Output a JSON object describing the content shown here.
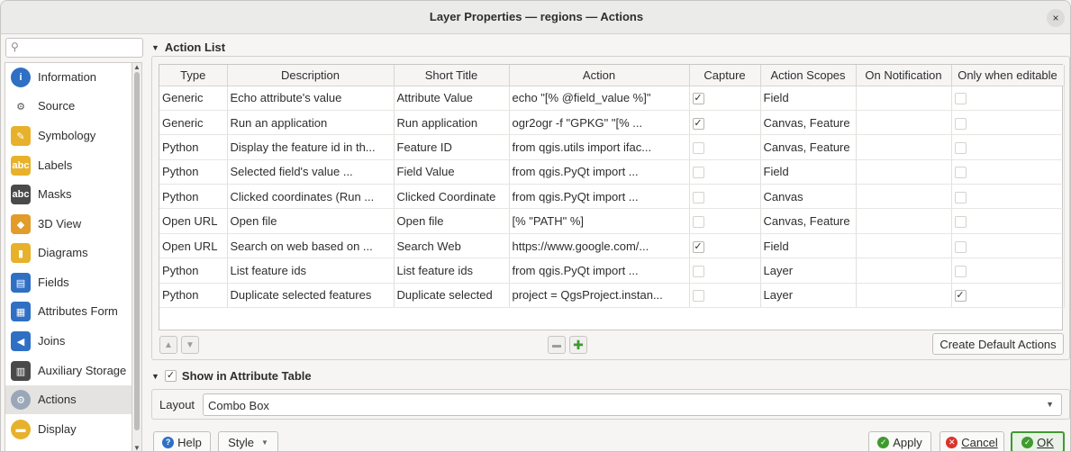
{
  "window": {
    "title": "Layer Properties — regions — Actions",
    "close_glyph": "×"
  },
  "search": {
    "placeholder": ""
  },
  "sidebar": {
    "items": [
      {
        "label": "Information",
        "icon": "info-icon"
      },
      {
        "label": "Source",
        "icon": "source-icon"
      },
      {
        "label": "Symbology",
        "icon": "symbology-icon"
      },
      {
        "label": "Labels",
        "icon": "labels-icon"
      },
      {
        "label": "Masks",
        "icon": "masks-icon"
      },
      {
        "label": "3D View",
        "icon": "3d-view-icon"
      },
      {
        "label": "Diagrams",
        "icon": "diagrams-icon"
      },
      {
        "label": "Fields",
        "icon": "fields-icon"
      },
      {
        "label": "Attributes Form",
        "icon": "attributes-form-icon"
      },
      {
        "label": "Joins",
        "icon": "joins-icon"
      },
      {
        "label": "Auxiliary Storage",
        "icon": "auxiliary-storage-icon"
      },
      {
        "label": "Actions",
        "icon": "actions-icon",
        "active": true
      },
      {
        "label": "Display",
        "icon": "display-icon"
      }
    ]
  },
  "action_list": {
    "title": "Action List",
    "columns": [
      "Type",
      "Description",
      "Short Title",
      "Action",
      "Capture",
      "Action Scopes",
      "On Notification",
      "Only when editable"
    ],
    "rows": [
      {
        "type": "Generic",
        "description": "Echo attribute's value",
        "short_title": "Attribute Value",
        "action": "echo \"[% @field_value %]\"",
        "capture": true,
        "scopes": "Field",
        "notification": "",
        "editable": false
      },
      {
        "type": "Generic",
        "description": "Run an application",
        "short_title": "Run application",
        "action": "ogr2ogr -f \"GPKG\" \"[% ...",
        "capture": true,
        "scopes": "Canvas, Feature",
        "notification": "",
        "editable": false
      },
      {
        "type": "Python",
        "description": "Display the feature id in th...",
        "short_title": "Feature ID",
        "action": "from qgis.utils import ifac...",
        "capture": false,
        "scopes": "Canvas, Feature",
        "notification": "",
        "editable": false
      },
      {
        "type": "Python",
        "description": "Selected field's value ...",
        "short_title": "Field Value",
        "action": "from qgis.PyQt import ...",
        "capture": false,
        "scopes": "Field",
        "notification": "",
        "editable": false
      },
      {
        "type": "Python",
        "description": "Clicked coordinates (Run ...",
        "short_title": "Clicked Coordinate",
        "action": "from qgis.PyQt import ...",
        "capture": false,
        "scopes": "Canvas",
        "notification": "",
        "editable": false
      },
      {
        "type": "Open URL",
        "description": "Open file",
        "short_title": "Open file",
        "action": "[% \"PATH\" %]",
        "capture": false,
        "scopes": "Canvas, Feature",
        "notification": "",
        "editable": false
      },
      {
        "type": "Open URL",
        "description": "Search on web based on ...",
        "short_title": "Search Web",
        "action": "https://www.google.com/...",
        "capture": true,
        "scopes": "Field",
        "notification": "",
        "editable": false
      },
      {
        "type": "Python",
        "description": "List feature ids",
        "short_title": "List feature ids",
        "action": "from qgis.PyQt import ...",
        "capture": false,
        "scopes": "Layer",
        "notification": "",
        "editable": false
      },
      {
        "type": "Python",
        "description": "Duplicate selected features",
        "short_title": "Duplicate selected",
        "action": "project = QgsProject.instan...",
        "capture": false,
        "scopes": "Layer",
        "notification": "",
        "editable": true
      }
    ],
    "create_default_label": "Create Default Actions"
  },
  "show_in_table": {
    "label": "Show in Attribute Table",
    "checked": true
  },
  "layout": {
    "label": "Layout",
    "value": "Combo Box"
  },
  "buttons": {
    "help": "Help",
    "style": "Style",
    "apply": "Apply",
    "cancel": "Cancel",
    "ok": "OK"
  },
  "colors": {
    "accent_green": "#3f9a2f",
    "cancel_red": "#d9342b",
    "help_blue": "#2f6fc4"
  }
}
